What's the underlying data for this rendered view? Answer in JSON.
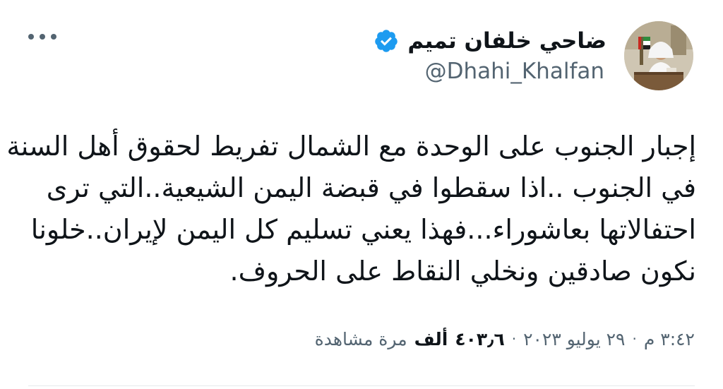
{
  "author": {
    "display_name": "ضاحي خلفان تميم",
    "handle": "@Dhahi_Khalfan",
    "verified": true,
    "avatar_icon": "profile-photo"
  },
  "tweet": {
    "lines": [
      "إجبار الجنوب على الوحدة مع الشمال تفريط لحقوق أهل السنة",
      "في الجنوب ..اذا سقطوا في قبضة اليمن الشيعية..التي ترى",
      "احتفالاتها بعاشوراء...فهذا يعني تسليم كل اليمن لإيران..خلونا",
      "نكون صادقين ونخلي النقاط على الحروف."
    ]
  },
  "meta": {
    "time": "٣:٤٢ م",
    "separator": "·",
    "date": "٢٩ يوليو ٢٠٢٣",
    "views_count": "٤٠٣٫٦",
    "views_unit": "ألف",
    "views_label": "مرة مشاهدة"
  },
  "colors": {
    "verified_blue": "#1d9bf0",
    "text_primary": "#0f1419",
    "text_secondary": "#536471"
  },
  "icons": {
    "verified": "verified-badge-icon",
    "more": "more-options-icon"
  }
}
